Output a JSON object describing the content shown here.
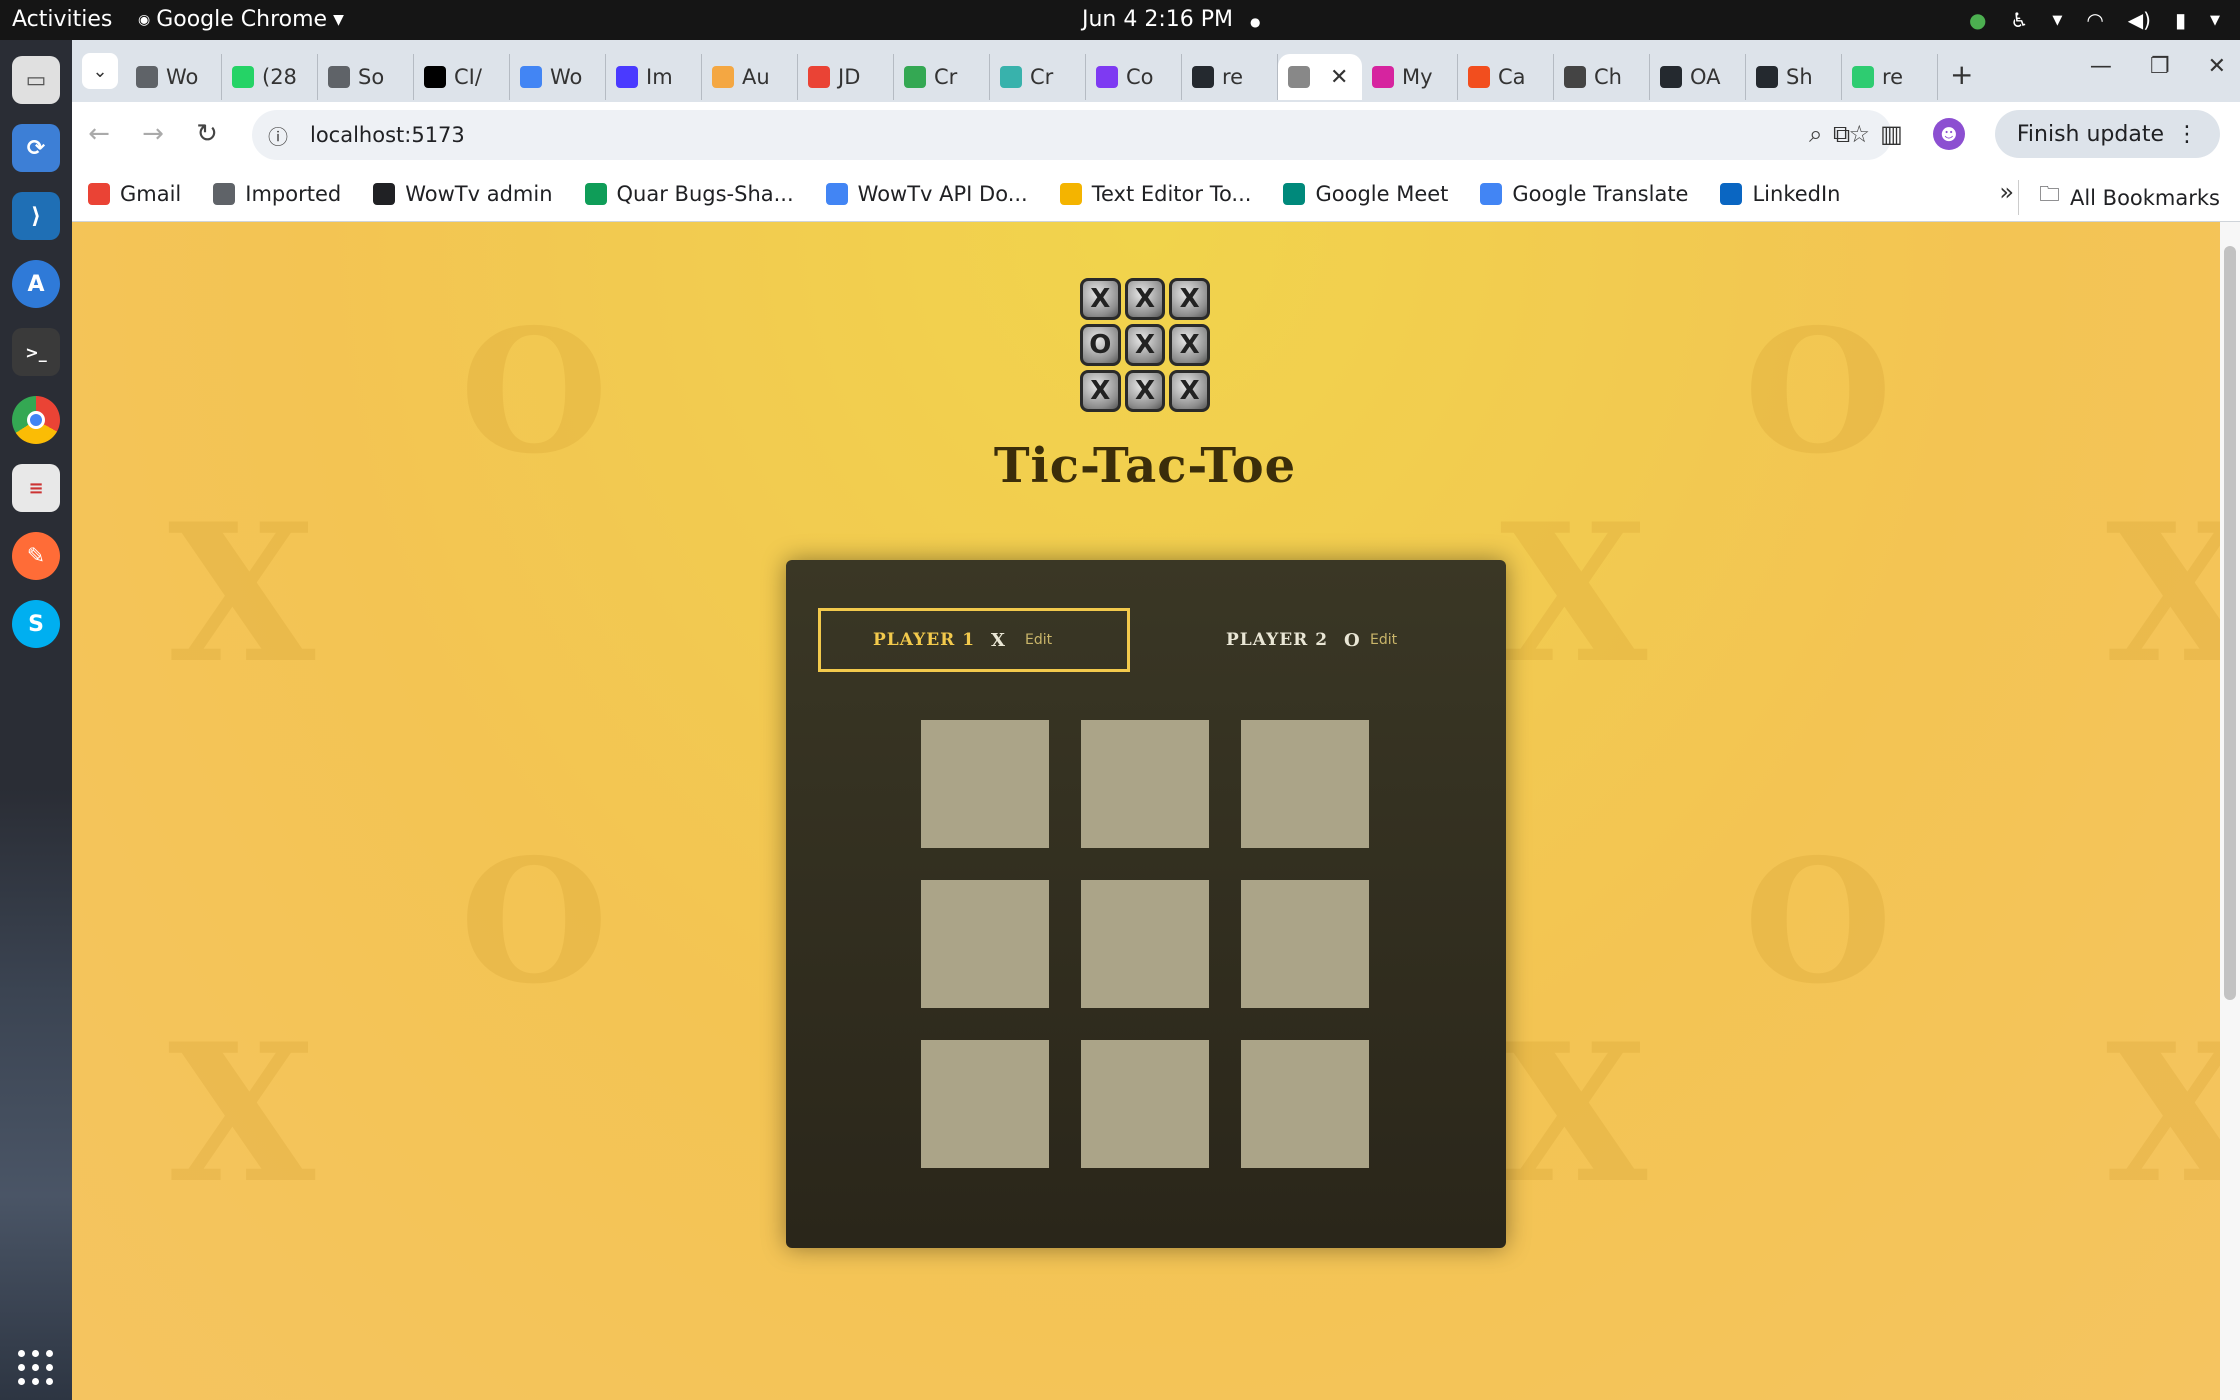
{
  "system": {
    "activities": "Activities",
    "app_name": "Google Chrome",
    "clock": "Jun 4  2:16 PM"
  },
  "dock": {
    "apps": [
      "Files",
      "Software Updater",
      "Visual Studio Code",
      "App Store",
      "Terminal",
      "Google Chrome",
      "Text Editor",
      "Postman",
      "Skype"
    ]
  },
  "browser": {
    "tabs": [
      {
        "label": "Wo",
        "icon": "globe-icon",
        "color": "#5f6368"
      },
      {
        "label": "(28",
        "icon": "whatsapp-icon",
        "color": "#25d366"
      },
      {
        "label": "So",
        "icon": "globe-icon",
        "color": "#5f6368"
      },
      {
        "label": "CI/",
        "icon": "medium-icon",
        "color": "#000000"
      },
      {
        "label": "Wo",
        "icon": "docs-icon",
        "color": "#4285f4"
      },
      {
        "label": "Im",
        "icon": "jira-icon",
        "color": "#4a3aff"
      },
      {
        "label": "Au",
        "icon": "bracket-icon",
        "color": "#f4a742"
      },
      {
        "label": "JD",
        "icon": "gmail-icon",
        "color": "#ea4335"
      },
      {
        "label": "Cr",
        "icon": "drive-icon",
        "color": "#34a853"
      },
      {
        "label": "Cr",
        "icon": "shield-icon",
        "color": "#38b2ac"
      },
      {
        "label": "Co",
        "icon": "info-icon",
        "color": "#7e3af2"
      },
      {
        "label": "re",
        "icon": "github-icon",
        "color": "#24292f"
      },
      {
        "label": "",
        "icon": "tictactoe-icon",
        "color": "#888888",
        "active": true
      },
      {
        "label": "My",
        "icon": "circle-icon",
        "color": "#d6249f"
      },
      {
        "label": "Ca",
        "icon": "canva-icon",
        "color": "#f24e1e"
      },
      {
        "label": "Ch",
        "icon": "openai-icon",
        "color": "#444444"
      },
      {
        "label": "OA",
        "icon": "github-icon",
        "color": "#24292f"
      },
      {
        "label": "Sh",
        "icon": "github-icon",
        "color": "#24292f"
      },
      {
        "label": "re",
        "icon": "replit-icon",
        "color": "#2ecc71"
      }
    ],
    "url": "localhost:5173",
    "finish_update": "Finish update",
    "bookmarks": [
      {
        "label": "Gmail",
        "icon": "gmail-icon",
        "color": "#ea4335"
      },
      {
        "label": "Imported",
        "icon": "folder-icon",
        "color": "#5f6368"
      },
      {
        "label": "WowTv admin",
        "icon": "globe-icon",
        "color": "#202124"
      },
      {
        "label": "Quar Bugs-Sha...",
        "icon": "sheets-icon",
        "color": "#0f9d58"
      },
      {
        "label": "WowTv API Do...",
        "icon": "docs-icon",
        "color": "#4285f4"
      },
      {
        "label": "Text Editor To...",
        "icon": "chrome-icon",
        "color": "#f4b400"
      },
      {
        "label": "Google Meet",
        "icon": "meet-icon",
        "color": "#00897b"
      },
      {
        "label": "Google Translate",
        "icon": "translate-icon",
        "color": "#4285f4"
      },
      {
        "label": "LinkedIn",
        "icon": "linkedin-icon",
        "color": "#0a66c2"
      }
    ],
    "all_bookmarks": "All Bookmarks"
  },
  "game": {
    "title": "Tic-Tac-Toe",
    "logo_cells": [
      "X",
      "X",
      "X",
      "O",
      "X",
      "X",
      "X",
      "X",
      "X"
    ],
    "players": [
      {
        "name": "Player 1",
        "symbol": "X",
        "edit": "Edit",
        "active": true
      },
      {
        "name": "Player 2",
        "symbol": "O",
        "edit": "Edit",
        "active": false
      }
    ],
    "board": [
      "",
      "",
      "",
      "",
      "",
      "",
      "",
      "",
      ""
    ],
    "accent_color": "#f2c94c",
    "cell_color": "#aba488"
  }
}
